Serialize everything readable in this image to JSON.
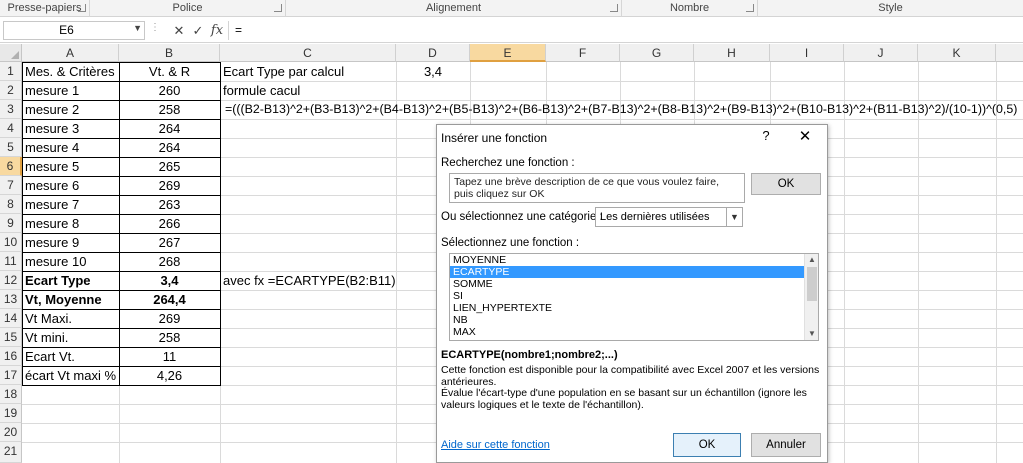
{
  "ribbon": {
    "groups": [
      {
        "label": "Presse-papiers"
      },
      {
        "label": "Police"
      },
      {
        "label": "Alignement"
      },
      {
        "label": "Nombre"
      },
      {
        "label": "Style"
      }
    ]
  },
  "formula_bar": {
    "name_box": "E6",
    "cancel_icon": "✕",
    "enter_icon": "✓",
    "fx_label": "fx",
    "content": "="
  },
  "sheet": {
    "columns": [
      "A",
      "B",
      "C",
      "D",
      "E",
      "F",
      "G",
      "H",
      "I",
      "J",
      "K"
    ],
    "rows": [
      "1",
      "2",
      "3",
      "4",
      "5",
      "6",
      "7",
      "8",
      "9",
      "10",
      "11",
      "12",
      "13",
      "14",
      "15",
      "16",
      "17",
      "18",
      "19",
      "20",
      "21"
    ],
    "active_column": "E",
    "active_row": "6",
    "cells": {
      "A1": "Mes. & Critères",
      "B1": "Vt. & R",
      "C1": "Ecart Type par calcul",
      "D1": "3,4",
      "A2": "mesure 1",
      "B2": "260",
      "C2": "formule cacul",
      "A3": "mesure 2",
      "B3": "258",
      "C3": "=(((B2-B13)^2+(B3-B13)^2+(B4-B13)^2+(B5-B13)^2+(B6-B13)^2+(B7-B13)^2+(B8-B13)^2+(B9-B13)^2+(B10-B13)^2+(B11-B13)^2)/(10-1))^(0,5)",
      "A4": "mesure 3",
      "B4": "264",
      "A5": "mesure 4",
      "B5": "264",
      "A6": "mesure 5",
      "B6": "265",
      "A7": "mesure 6",
      "B7": "269",
      "A8": "mesure 7",
      "B8": "263",
      "A9": "mesure 8",
      "B9": "266",
      "A10": "mesure 9",
      "B10": "267",
      "A11": "mesure 10",
      "B11": "268",
      "A12": "Ecart Type",
      "B12": "3,4",
      "C12": "avec fx  =ECARTYPE(B2:B11)",
      "A13": "Vt, Moyenne",
      "B13": "264,4",
      "A14": "Vt Maxi.",
      "B14": "269",
      "A15": "Vt mini.",
      "B15": "258",
      "A16": "Ecart Vt.",
      "B16": "11",
      "A17": "écart Vt maxi %",
      "B17": "4,26"
    }
  },
  "dialog": {
    "title": "Insérer une fonction",
    "help": "?",
    "close": "✕",
    "search_label": "Recherchez une fonction :",
    "search_text": "Tapez une brève description de ce que vous voulez faire, puis cliquez sur OK",
    "ok_top": "OK",
    "category_label": "Ou sélectionnez une catégorie :",
    "category_value": "Les dernières utilisées",
    "function_label": "Sélectionnez une fonction :",
    "functions": [
      "MOYENNE",
      "ECARTYPE",
      "SOMME",
      "SI",
      "LIEN_HYPERTEXTE",
      "NB",
      "MAX"
    ],
    "selected_function": "ECARTYPE",
    "syntax": "ECARTYPE(nombre1;nombre2;...)",
    "desc1": "Cette fonction est disponible pour la compatibilité avec Excel 2007 et les versions antérieures.",
    "desc2": "Évalue l'écart-type d'une population en se basant sur un échantillon (ignore les valeurs logiques et le texte de l'échantillon).",
    "help_link": "Aide sur cette fonction",
    "ok": "OK",
    "cancel": "Annuler"
  }
}
